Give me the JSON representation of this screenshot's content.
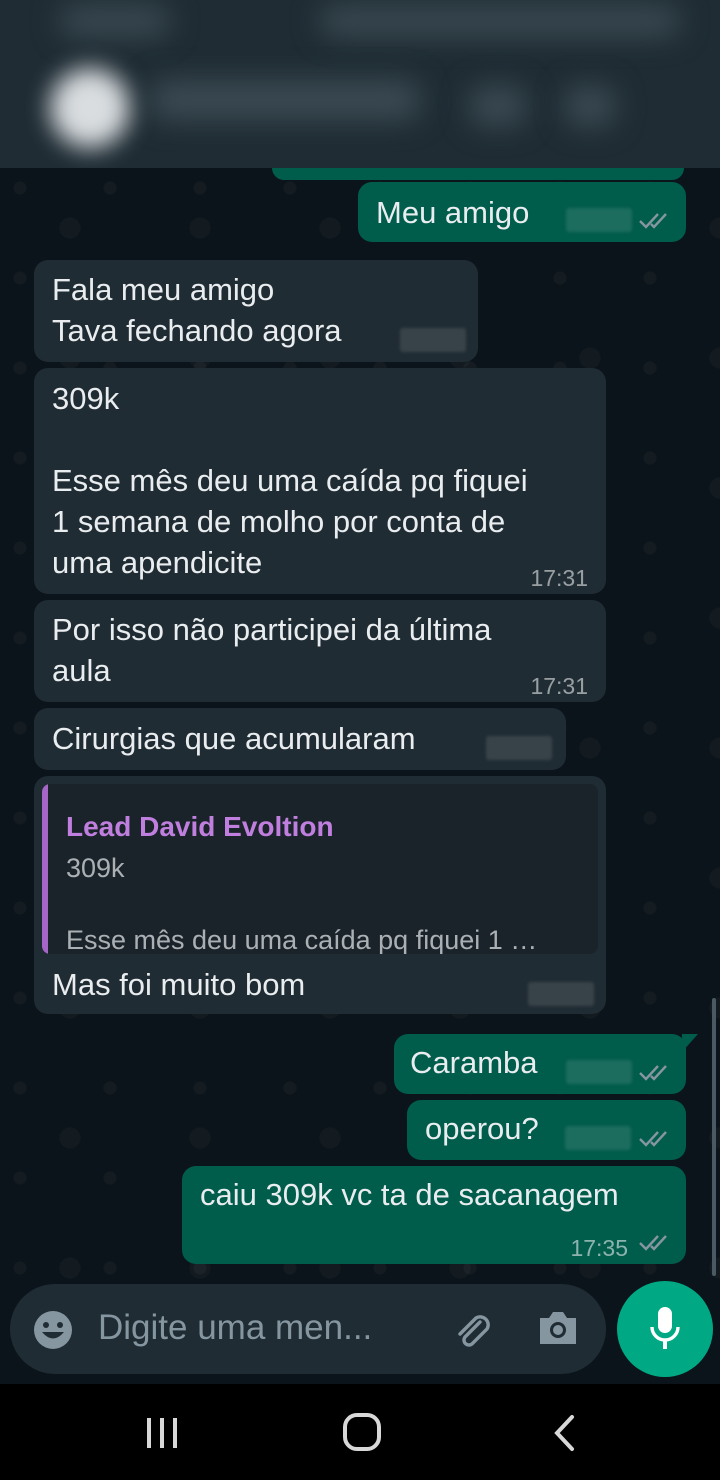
{
  "messages": [
    {
      "id": "m1",
      "dir": "out",
      "text": "Meu amigo",
      "time": ""
    },
    {
      "id": "m2",
      "dir": "in",
      "text": "Fala meu amigo\nTava fechando agora",
      "time": ""
    },
    {
      "id": "m3",
      "dir": "in",
      "text": "309k\n\nEsse mês deu uma caída pq fiquei\n1 semana de molho por conta de\numa apendicite",
      "time": "17:31"
    },
    {
      "id": "m4",
      "dir": "in",
      "text": "Por isso não participei da última\naula",
      "time": "17:31"
    },
    {
      "id": "m5",
      "dir": "in",
      "text": "Cirurgias que acumularam",
      "time": ""
    },
    {
      "id": "m6",
      "dir": "in",
      "text": "Mas foi muito bom",
      "time": "",
      "reply": {
        "name": "Lead David Evoltion",
        "line1": "309k",
        "line2": "Esse mês deu uma caída pq fiquei 1 …"
      }
    },
    {
      "id": "m7",
      "dir": "out",
      "text": "Caramba",
      "time": ""
    },
    {
      "id": "m8",
      "dir": "out",
      "text": "operou?",
      "time": ""
    },
    {
      "id": "m9",
      "dir": "out",
      "text": "caiu 309k vc ta de sacanagem",
      "time": "17:35"
    }
  ],
  "input": {
    "placeholder": "Digite uma men..."
  },
  "icons": {
    "emoji": "emoji-icon",
    "attach": "paperclip-icon",
    "camera": "camera-icon",
    "mic": "microphone-icon",
    "nav_recents": "recents-icon",
    "nav_home": "home-icon",
    "nav_back": "back-icon"
  },
  "colors": {
    "incoming": "#202c33",
    "outgoing": "#005c4b",
    "accent": "#00a884",
    "reply_name": "#c07fde"
  }
}
